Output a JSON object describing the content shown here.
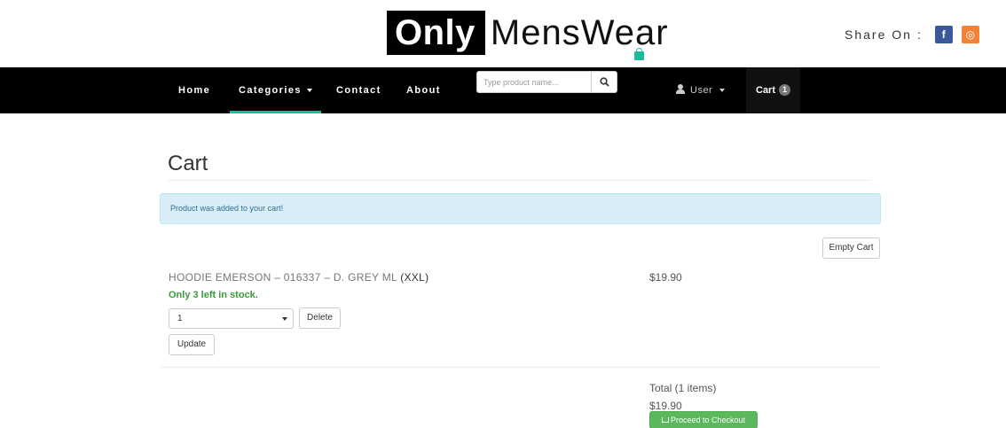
{
  "brand": {
    "logo_bold": "Only",
    "logo_rest": "MensWear"
  },
  "share": {
    "label": "Share On :",
    "icons": [
      "facebook-icon",
      "instagram-icon"
    ],
    "facebook_glyph": "f",
    "instagram_glyph": "◎"
  },
  "nav": {
    "home": "Home",
    "categories": "Categories",
    "contact": "Contact",
    "about": "About",
    "search_placeholder": "Type product name...",
    "user": "User",
    "cart": "Cart",
    "cart_count": "1",
    "accent_color": "#1abc9c"
  },
  "page": {
    "title": "Cart",
    "alert": "Product was added to your cart!",
    "empty_cart": "Empty Cart"
  },
  "cart_item": {
    "name": "HOODIE EMERSON – 016337 – D. GREY ML",
    "size": "(XXL)",
    "stock": "Only 3 left in stock.",
    "quantity": "1",
    "delete": "Delete",
    "update": "Update",
    "price": "$19.90"
  },
  "summary": {
    "total_label": "Total (1 items)",
    "total_value": "$19.90",
    "checkout": "Proceed to Checkout"
  }
}
